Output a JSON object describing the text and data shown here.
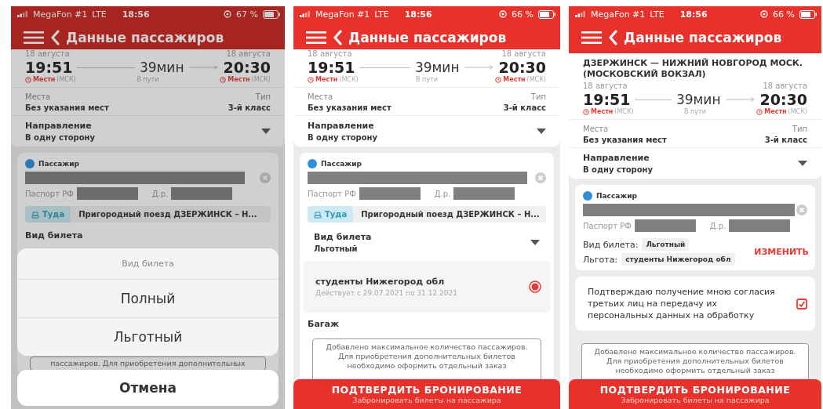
{
  "screens": [
    {
      "dimmed": true,
      "status_bar": {
        "carrier": "MegaFon #1",
        "network": "LTE",
        "time": "18:56",
        "battery": "67 %"
      },
      "header": {
        "title": "Данные пассажиров"
      },
      "blocks": [
        {
          "kind": "times",
          "dep_date": "18 августа",
          "dep_time": "19:51",
          "dep_zone": "Местн",
          "dep_zone_note": "(МСК)",
          "duration": "39мин",
          "duration_label": "В пути",
          "arr_date": "18 августа",
          "arr_time": "20:30",
          "arr_zone": "Местн",
          "arr_zone_note": "(МСК)"
        },
        {
          "kind": "seats",
          "left_label": "Места",
          "left_value": "Без указания мест",
          "right_label": "Тип",
          "right_value": "3-й класс"
        },
        {
          "kind": "select",
          "label": "Направление",
          "value": "В одну сторону"
        },
        {
          "kind": "passenger",
          "label": "Пассажир",
          "passport_label": "Паспорт РФ",
          "birth_label": "Д.р.",
          "trip_tag": "Туда",
          "train": "Пригородный поезд ДЗЕРЖИНСК – Н..."
        },
        {
          "kind": "heading",
          "text": "Вид билета"
        },
        {
          "kind": "notice",
          "text": "пассажиров. Для приобретения дополнительных"
        }
      ],
      "sheet": {
        "title": "Вид билета",
        "options": [
          "Полный",
          "Льготный"
        ],
        "cancel": "Отмена"
      }
    },
    {
      "dimmed": false,
      "status_bar": {
        "carrier": "MegaFon #1",
        "network": "LTE",
        "time": "18:56",
        "battery": "66 %"
      },
      "header": {
        "title": "Данные пассажиров"
      },
      "blocks": [
        {
          "kind": "times",
          "dep_date": "18 августа",
          "dep_time": "19:51",
          "dep_zone": "Местн",
          "dep_zone_note": "(МСК)",
          "duration": "39мин",
          "duration_label": "В пути",
          "arr_date": "18 августа",
          "arr_time": "20:30",
          "arr_zone": "Местн",
          "arr_zone_note": "(МСК)"
        },
        {
          "kind": "seats",
          "left_label": "Места",
          "left_value": "Без указания мест",
          "right_label": "Тип",
          "right_value": "3-й класс"
        },
        {
          "kind": "select",
          "label": "Направление",
          "value": "В одну сторону"
        },
        {
          "kind": "passenger",
          "label": "Пассажир",
          "passport_label": "Паспорт РФ",
          "birth_label": "Д.р.",
          "trip_tag": "Туда",
          "train": "Пригородный поезд ДЗЕРЖИНСК – Н..."
        },
        {
          "kind": "select",
          "label": "Вид билета",
          "value": "Льготный"
        },
        {
          "kind": "benefit",
          "title": "студенты Нижегород обл",
          "subtitle": "Действует с 29.07.2021 по 31.12.2021",
          "selected": true
        },
        {
          "kind": "heading",
          "text": "Багаж"
        },
        {
          "kind": "notice",
          "text": "Добавлено максимальное количество пассажиров. Для приобретения дополнительных билетов необходимо оформить отдельный заказ"
        }
      ],
      "footer": {
        "title": "ПОДТВЕРДИТЬ БРОНИРОВАНИЕ",
        "subtitle": "Забронировать билеты на пассажира"
      }
    },
    {
      "dimmed": false,
      "status_bar": {
        "carrier": "MegaFon #1",
        "network": "LTE",
        "time": "18:56",
        "battery": "66 %"
      },
      "header": {
        "title": "Данные пассажиров"
      },
      "blocks": [
        {
          "kind": "route",
          "text": "ДЗЕРЖИНСК — НИЖНИЙ НОВГОРОД МОСК. (МОСКОВСКИЙ ВОКЗАЛ)"
        },
        {
          "kind": "times",
          "dep_date": "18 августа",
          "dep_time": "19:51",
          "dep_zone": "Местн",
          "dep_zone_note": "(МСК)",
          "duration": "39мин",
          "duration_label": "В пути",
          "arr_date": "18 августа",
          "arr_time": "20:30",
          "arr_zone": "Местн",
          "arr_zone_note": "(МСК)"
        },
        {
          "kind": "seats",
          "left_label": "Места",
          "left_value": "Без указания мест",
          "right_label": "Тип",
          "right_value": "3-й класс"
        },
        {
          "kind": "select",
          "label": "Направление",
          "value": "В одну сторону"
        },
        {
          "kind": "passenger",
          "label": "Пассажир",
          "passport_label": "Паспорт РФ",
          "birth_label": "Д.р.",
          "summary": [
            {
              "label": "Вид билета:",
              "value": "Льготный"
            },
            {
              "label": "Льгота:",
              "value": "студенты Нижегород обл"
            }
          ],
          "action": "ИЗМЕНИТЬ"
        },
        {
          "kind": "consent",
          "text": "Подтверждаю получение мною согласия третьих лиц на передачу их персональных данных на обработку",
          "checked": true
        },
        {
          "kind": "notice",
          "text": "Добавлено максимальное количество пассажиров. Для приобретения дополнительных билетов необходимо оформить отдельный заказ"
        }
      ],
      "footer": {
        "title": "ПОДТВЕРДИТЬ БРОНИРОВАНИЕ",
        "subtitle": "Забронировать билеты на пассажира"
      }
    }
  ]
}
